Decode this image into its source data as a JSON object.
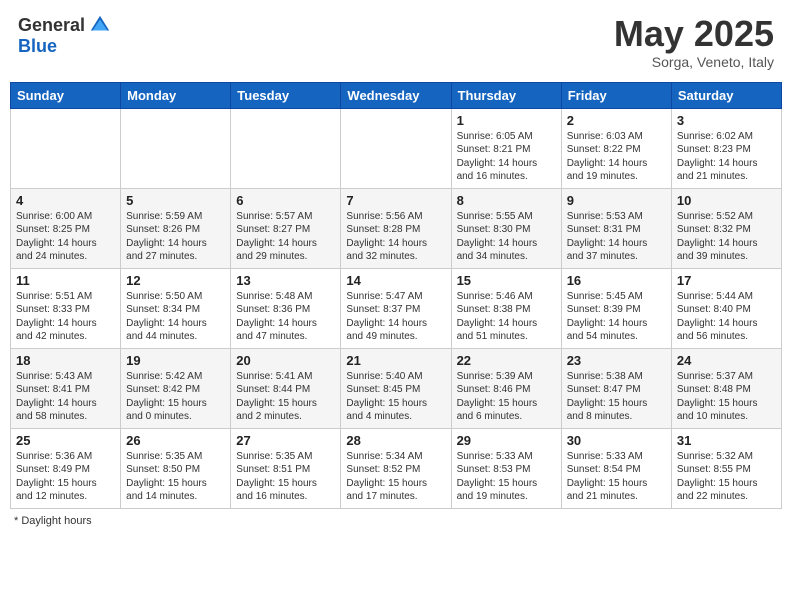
{
  "header": {
    "logo_general": "General",
    "logo_blue": "Blue",
    "title": "May 2025",
    "subtitle": "Sorga, Veneto, Italy"
  },
  "days_of_week": [
    "Sunday",
    "Monday",
    "Tuesday",
    "Wednesday",
    "Thursday",
    "Friday",
    "Saturday"
  ],
  "weeks": [
    [
      {
        "day": "",
        "content": ""
      },
      {
        "day": "",
        "content": ""
      },
      {
        "day": "",
        "content": ""
      },
      {
        "day": "",
        "content": ""
      },
      {
        "day": "1",
        "content": "Sunrise: 6:05 AM\nSunset: 8:21 PM\nDaylight: 14 hours and 16 minutes."
      },
      {
        "day": "2",
        "content": "Sunrise: 6:03 AM\nSunset: 8:22 PM\nDaylight: 14 hours and 19 minutes."
      },
      {
        "day": "3",
        "content": "Sunrise: 6:02 AM\nSunset: 8:23 PM\nDaylight: 14 hours and 21 minutes."
      }
    ],
    [
      {
        "day": "4",
        "content": "Sunrise: 6:00 AM\nSunset: 8:25 PM\nDaylight: 14 hours and 24 minutes."
      },
      {
        "day": "5",
        "content": "Sunrise: 5:59 AM\nSunset: 8:26 PM\nDaylight: 14 hours and 27 minutes."
      },
      {
        "day": "6",
        "content": "Sunrise: 5:57 AM\nSunset: 8:27 PM\nDaylight: 14 hours and 29 minutes."
      },
      {
        "day": "7",
        "content": "Sunrise: 5:56 AM\nSunset: 8:28 PM\nDaylight: 14 hours and 32 minutes."
      },
      {
        "day": "8",
        "content": "Sunrise: 5:55 AM\nSunset: 8:30 PM\nDaylight: 14 hours and 34 minutes."
      },
      {
        "day": "9",
        "content": "Sunrise: 5:53 AM\nSunset: 8:31 PM\nDaylight: 14 hours and 37 minutes."
      },
      {
        "day": "10",
        "content": "Sunrise: 5:52 AM\nSunset: 8:32 PM\nDaylight: 14 hours and 39 minutes."
      }
    ],
    [
      {
        "day": "11",
        "content": "Sunrise: 5:51 AM\nSunset: 8:33 PM\nDaylight: 14 hours and 42 minutes."
      },
      {
        "day": "12",
        "content": "Sunrise: 5:50 AM\nSunset: 8:34 PM\nDaylight: 14 hours and 44 minutes."
      },
      {
        "day": "13",
        "content": "Sunrise: 5:48 AM\nSunset: 8:36 PM\nDaylight: 14 hours and 47 minutes."
      },
      {
        "day": "14",
        "content": "Sunrise: 5:47 AM\nSunset: 8:37 PM\nDaylight: 14 hours and 49 minutes."
      },
      {
        "day": "15",
        "content": "Sunrise: 5:46 AM\nSunset: 8:38 PM\nDaylight: 14 hours and 51 minutes."
      },
      {
        "day": "16",
        "content": "Sunrise: 5:45 AM\nSunset: 8:39 PM\nDaylight: 14 hours and 54 minutes."
      },
      {
        "day": "17",
        "content": "Sunrise: 5:44 AM\nSunset: 8:40 PM\nDaylight: 14 hours and 56 minutes."
      }
    ],
    [
      {
        "day": "18",
        "content": "Sunrise: 5:43 AM\nSunset: 8:41 PM\nDaylight: 14 hours and 58 minutes."
      },
      {
        "day": "19",
        "content": "Sunrise: 5:42 AM\nSunset: 8:42 PM\nDaylight: 15 hours and 0 minutes."
      },
      {
        "day": "20",
        "content": "Sunrise: 5:41 AM\nSunset: 8:44 PM\nDaylight: 15 hours and 2 minutes."
      },
      {
        "day": "21",
        "content": "Sunrise: 5:40 AM\nSunset: 8:45 PM\nDaylight: 15 hours and 4 minutes."
      },
      {
        "day": "22",
        "content": "Sunrise: 5:39 AM\nSunset: 8:46 PM\nDaylight: 15 hours and 6 minutes."
      },
      {
        "day": "23",
        "content": "Sunrise: 5:38 AM\nSunset: 8:47 PM\nDaylight: 15 hours and 8 minutes."
      },
      {
        "day": "24",
        "content": "Sunrise: 5:37 AM\nSunset: 8:48 PM\nDaylight: 15 hours and 10 minutes."
      }
    ],
    [
      {
        "day": "25",
        "content": "Sunrise: 5:36 AM\nSunset: 8:49 PM\nDaylight: 15 hours and 12 minutes."
      },
      {
        "day": "26",
        "content": "Sunrise: 5:35 AM\nSunset: 8:50 PM\nDaylight: 15 hours and 14 minutes."
      },
      {
        "day": "27",
        "content": "Sunrise: 5:35 AM\nSunset: 8:51 PM\nDaylight: 15 hours and 16 minutes."
      },
      {
        "day": "28",
        "content": "Sunrise: 5:34 AM\nSunset: 8:52 PM\nDaylight: 15 hours and 17 minutes."
      },
      {
        "day": "29",
        "content": "Sunrise: 5:33 AM\nSunset: 8:53 PM\nDaylight: 15 hours and 19 minutes."
      },
      {
        "day": "30",
        "content": "Sunrise: 5:33 AM\nSunset: 8:54 PM\nDaylight: 15 hours and 21 minutes."
      },
      {
        "day": "31",
        "content": "Sunrise: 5:32 AM\nSunset: 8:55 PM\nDaylight: 15 hours and 22 minutes."
      }
    ]
  ],
  "footer": {
    "note": "Daylight hours"
  }
}
